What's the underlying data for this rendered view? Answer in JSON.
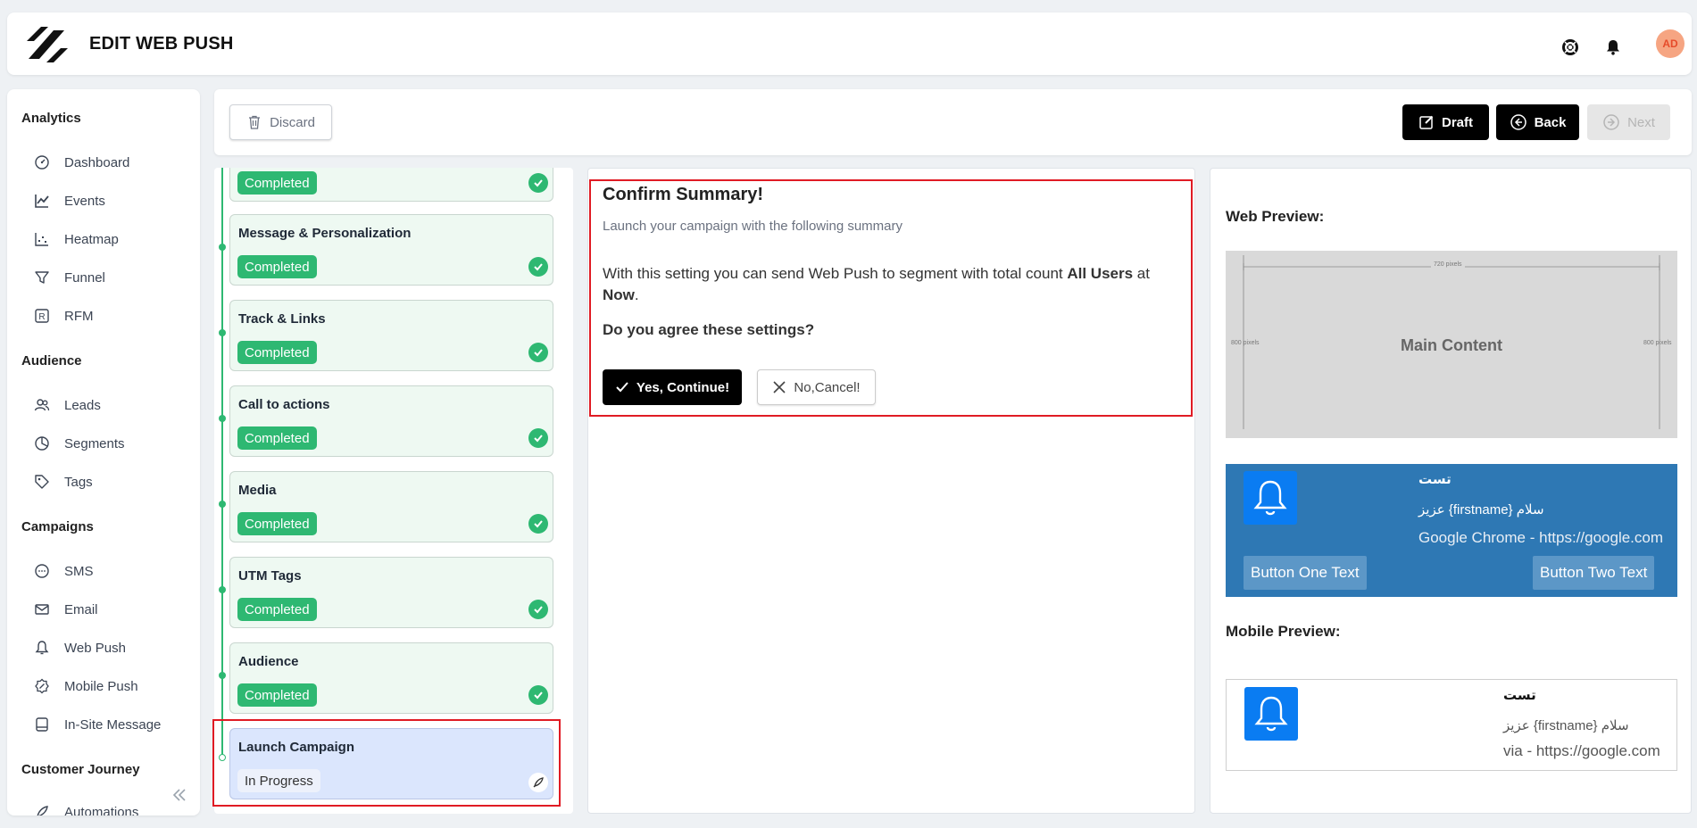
{
  "header": {
    "title": "EDIT WEB PUSH",
    "avatar": "AD"
  },
  "sidebar": {
    "sections": {
      "analytics": "Analytics",
      "audience": "Audience",
      "campaigns": "Campaigns",
      "journey": "Customer Journey"
    },
    "items": {
      "dashboard": "Dashboard",
      "events": "Events",
      "heatmap": "Heatmap",
      "funnel": "Funnel",
      "rfm": "RFM",
      "leads": "Leads",
      "segments": "Segments",
      "tags": "Tags",
      "sms": "SMS",
      "email": "Email",
      "webpush": "Web Push",
      "mobilepush": "Mobile Push",
      "insite": "In-Site Message",
      "automations": "Automations"
    }
  },
  "toolbar": {
    "discard": "Discard",
    "draft": "Draft",
    "back": "Back",
    "next": "Next"
  },
  "steps": {
    "completed_label": "Completed",
    "progress_label": "In Progress",
    "items": [
      {
        "title": "Message & Personalization"
      },
      {
        "title": "Track & Links"
      },
      {
        "title": "Call to actions"
      },
      {
        "title": "Media"
      },
      {
        "title": "UTM Tags"
      },
      {
        "title": "Audience"
      },
      {
        "title": "Launch Campaign"
      }
    ]
  },
  "summary": {
    "title": "Confirm Summary!",
    "subtitle": "Launch your campaign with the following summary",
    "text_before": "With this setting you can send Web Push to segment with total count ",
    "segment": "All Users",
    "text_mid": " at ",
    "time": "Now",
    "text_end": ".",
    "question": "Do you agree these settings?",
    "yes": "Yes, Continue!",
    "no": "No,Cancel!"
  },
  "preview": {
    "web_label": "Web Preview:",
    "mobile_label": "Mobile Preview:",
    "mock_main": "Main Content",
    "mock_width": "720 pixels",
    "mock_height": "800 pixels",
    "notif_title": "تست",
    "notif_body": "عزیز {firstname} سلام",
    "web_site": "Google Chrome - https://google.com",
    "mobile_site": "via - https://google.com",
    "button_one": "Button One Text",
    "button_two": "Button Two Text"
  },
  "colors": {
    "accent_green": "#2eb872",
    "web_notif_bg": "#2e78b4",
    "bell_blue": "#0a7cf2",
    "highlight_red": "#e01b24"
  }
}
